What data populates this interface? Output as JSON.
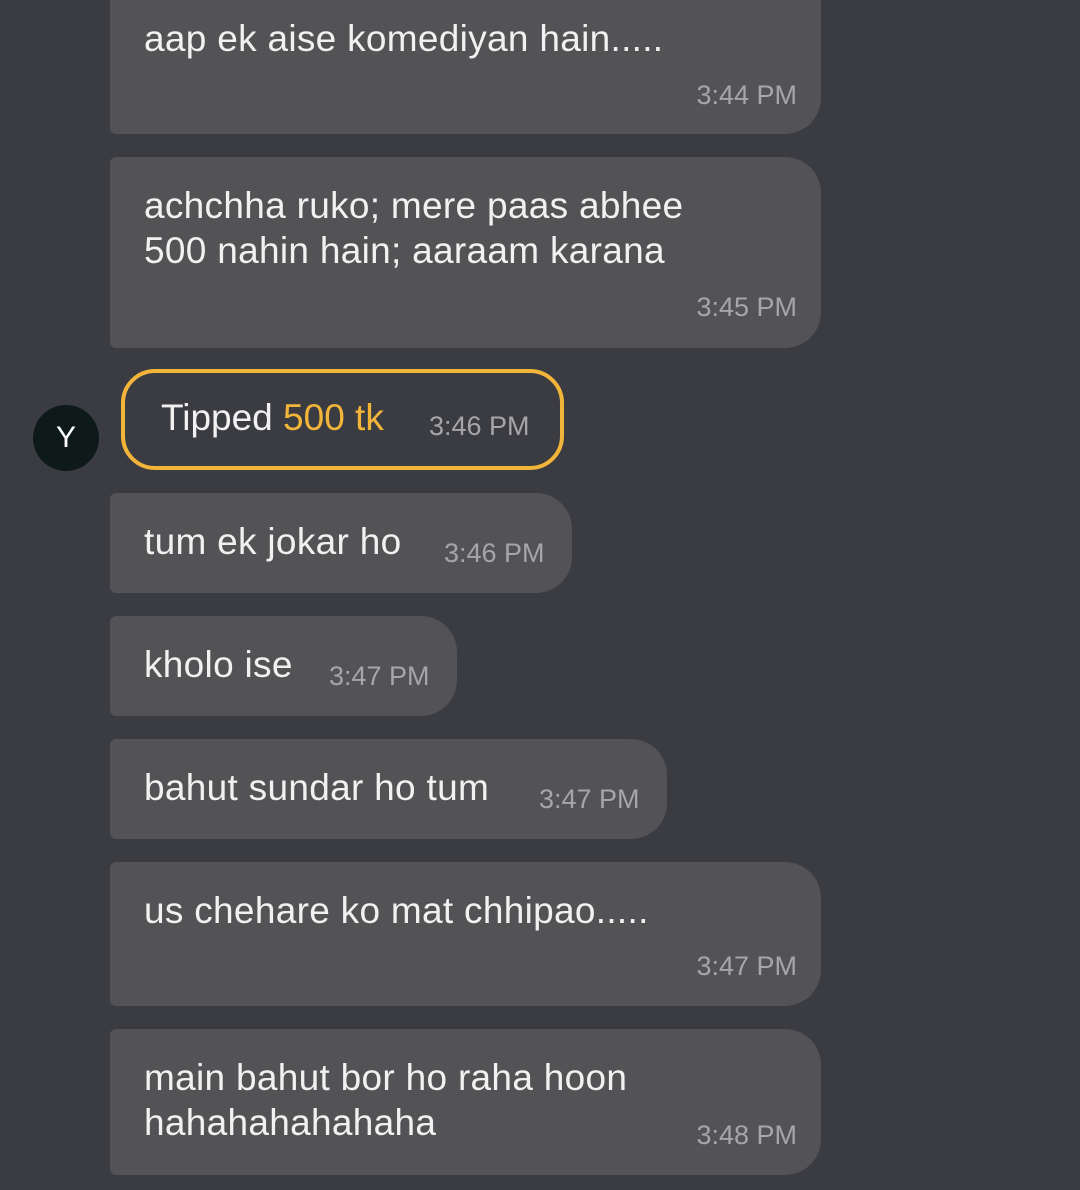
{
  "messages": [
    {
      "lines": [
        "aap ek aise komediyan hain....."
      ],
      "time": "3:44 PM"
    },
    {
      "lines": [
        "achchha ruko; mere paas abhee",
        "500 nahin hain; aaraam karana"
      ],
      "time": "3:45 PM"
    },
    {
      "lines": [
        "tum ek jokar ho"
      ],
      "time": "3:46 PM"
    },
    {
      "lines": [
        "kholo ise"
      ],
      "time": "3:47 PM"
    },
    {
      "lines": [
        "bahut sundar ho tum"
      ],
      "time": "3:47 PM"
    },
    {
      "lines": [
        "us chehare ko mat chhipao....."
      ],
      "time": "3:47 PM"
    },
    {
      "lines": [
        "main bahut bor ho raha hoon",
        "hahahahahahaha"
      ],
      "time": "3:48 PM"
    }
  ],
  "tip": {
    "avatar_initial": "Y",
    "label": "Tipped",
    "amount": "500 tk",
    "time": "3:46 PM"
  },
  "colors": {
    "background": "#3b3c41",
    "bubble": "#535356",
    "tip_accent": "#f2b53a",
    "timestamp": "#a6a6a8"
  }
}
